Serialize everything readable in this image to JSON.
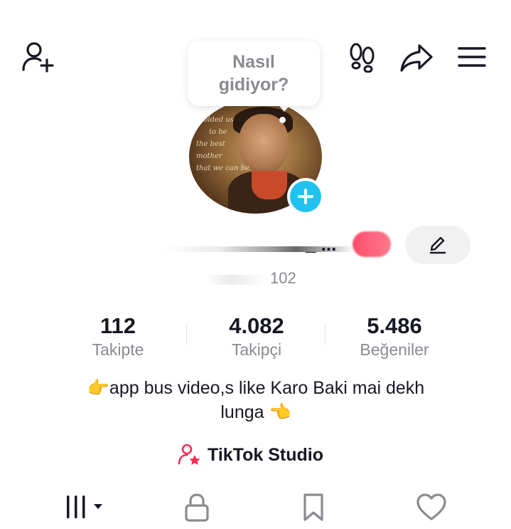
{
  "header": {
    "add_friend_icon": "person-plus-icon",
    "footprints_icon": "footprints-icon",
    "share_icon": "share-arrow-icon",
    "menu_icon": "hamburger-menu-icon"
  },
  "bubble": {
    "text_line1": "Nasıl",
    "text_line2": "gidiyor?"
  },
  "avatar": {
    "overlay_lines": [
      "Molded us",
      "to be",
      "the best mother",
      "that we can be."
    ]
  },
  "profile": {
    "name_visible": "_ ...",
    "handle_visible": "102"
  },
  "stats": [
    {
      "value": "112",
      "label": "Takipte"
    },
    {
      "value": "4.082",
      "label": "Takipçi"
    },
    {
      "value": "5.486",
      "label": "Beğeniler"
    }
  ],
  "bio": {
    "line1": "👉app bus video,s like Karo Baki mai dekh",
    "line2": "lunga 👈"
  },
  "studio": {
    "label": "TikTok Studio",
    "icon": "person-star-icon"
  },
  "tabs": [
    {
      "icon": "grid-bars-icon",
      "has_dropdown": true
    },
    {
      "icon": "lock-icon"
    },
    {
      "icon": "bookmark-icon"
    },
    {
      "icon": "heart-icon"
    }
  ],
  "colors": {
    "accent_blue": "#20c3f0",
    "accent_pink": "#fe2c55",
    "muted": "#8a8b91"
  }
}
